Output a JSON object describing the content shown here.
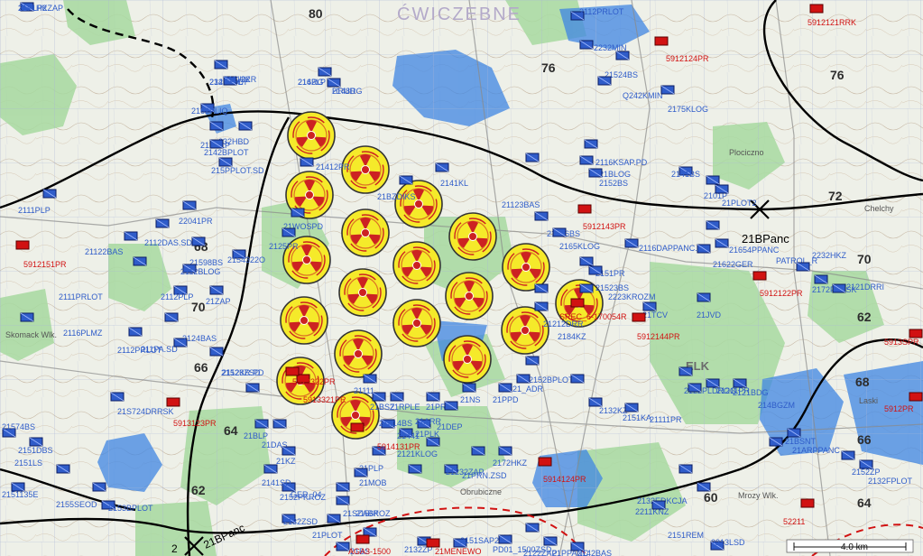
{
  "map": {
    "title_overlay": "ĆWICZEBNE",
    "scale_label": "4.0 km",
    "boundary_labels": [
      "21BPanc",
      "21BPanc",
      "2"
    ],
    "grid_labels": [
      "80",
      "76",
      "72",
      "70",
      "68",
      "66",
      "64",
      "62",
      "60",
      "68",
      "66",
      "64",
      "62",
      "70",
      "76"
    ],
    "town_labels": [
      "ELK",
      "Plociczno",
      "Chelchy",
      "Skomack Wlk.",
      "Mrozy Wlk.",
      "Obrubiczne",
      "Laski"
    ]
  },
  "friendly_units": [
    "2201HKZAP",
    "2322ZSD",
    "2162LP",
    "HRUD",
    "HRU02",
    "232HBD",
    "2162PLIQ",
    "21SBLP",
    "2142BPLOT",
    "215PPLOT.SD",
    "2111PLP",
    "22041PR",
    "21122BAS",
    "2112DAS.SD",
    "21598BS",
    "2112BLOG",
    "2154322O",
    "2111PRLOT",
    "2112PLP",
    "21ZAP",
    "2116PLMZ",
    "2112PRLOT",
    "211PA.SD",
    "2124BAS",
    "2152KR.PD",
    "21S724DRRSK",
    "21574BS",
    "2151DBS",
    "2151LS",
    "2151135E",
    "2155SEOD",
    "2153BPLOT",
    "21123BAS",
    "2112PRLOT",
    "2232MIN",
    "21524BS",
    "Q242KMIN",
    "2175KLOG",
    "2116KSAP.PD",
    "21BLOG",
    "2152BS",
    "21626BS",
    "2165KLOG",
    "2116DAPPANC.SD",
    "21654PPANC",
    "21622GER",
    "PATROL_R",
    "2232HKZ",
    "2172PLRSK",
    "2121DRRI",
    "2151PR",
    "21523BS",
    "2223KROZM",
    "21212DRR",
    "2184KZ",
    "2152BPLOT",
    "2132KZ",
    "2151KA",
    "21111PR",
    "2122PLDROG",
    "21211PR",
    "2121BDG",
    "214BGZM",
    "2132EDKCJA",
    "2211KNZ",
    "2151REM",
    "2152ZP",
    "2132FPLOT",
    "21BSNT",
    "21ARPPANC",
    "2141KL",
    "21BZDIKS",
    "21WOSPD",
    "2125PR",
    "21ARR",
    "21PLK",
    "2121KLOG",
    "21PLP",
    "21MOB",
    "GER_04",
    "2152PKROZ",
    "21SZABR",
    "21PLOT",
    "2132ZSD",
    "21232ZAP",
    "21PRN.ZSD",
    "2172HKZ",
    "2156KOZ",
    "2132ZP",
    "2151SAP2",
    "PD01_1500ZSD",
    "2122ZAP",
    "21PPANC",
    "2142BAS",
    "2213LSD",
    "21BS",
    "2141BS",
    "2101P",
    "21PLOT2",
    "21412PR",
    "21123ZSD",
    "21BLP",
    "21DAS",
    "21KZ",
    "2141SD",
    "21414BS",
    "21441",
    "21111",
    "21BSZ",
    "21RPLE",
    "21PRS",
    "21DEP",
    "21NS",
    "21PPD",
    "21_ADR",
    "21TCV",
    "21JVD",
    "21PLP2",
    "2142EDLY",
    "214RG",
    "2148RG",
    "21112KR"
  ],
  "enemy_units": [
    "5912124PR",
    "5912143PR",
    "5912151PR",
    "5912122PR",
    "5912144PR",
    "5913123PR",
    "5914124PR",
    "5913321PR",
    "5913322PR",
    "5914131PR",
    "52211",
    "AGA3-1500",
    "SREC_6-170054R",
    "21MENEWO",
    "5912121RRK",
    "5913SPR",
    "5912PR"
  ],
  "chem_markers": 19,
  "colors": {
    "friendly": "#2f5cc9",
    "enemy": "#d11212",
    "chem_fill": "#f5ea2a",
    "chem_symbol": "#cc2222",
    "water": "#3f86e3",
    "forest": "#9fd49a",
    "boundary": "#000000",
    "enemy_boundary": "#d11212"
  },
  "icons": [
    "unit-rect-icon",
    "enemy-unit-icon",
    "chemical-hazard-icon",
    "boundary-x-icon"
  ]
}
